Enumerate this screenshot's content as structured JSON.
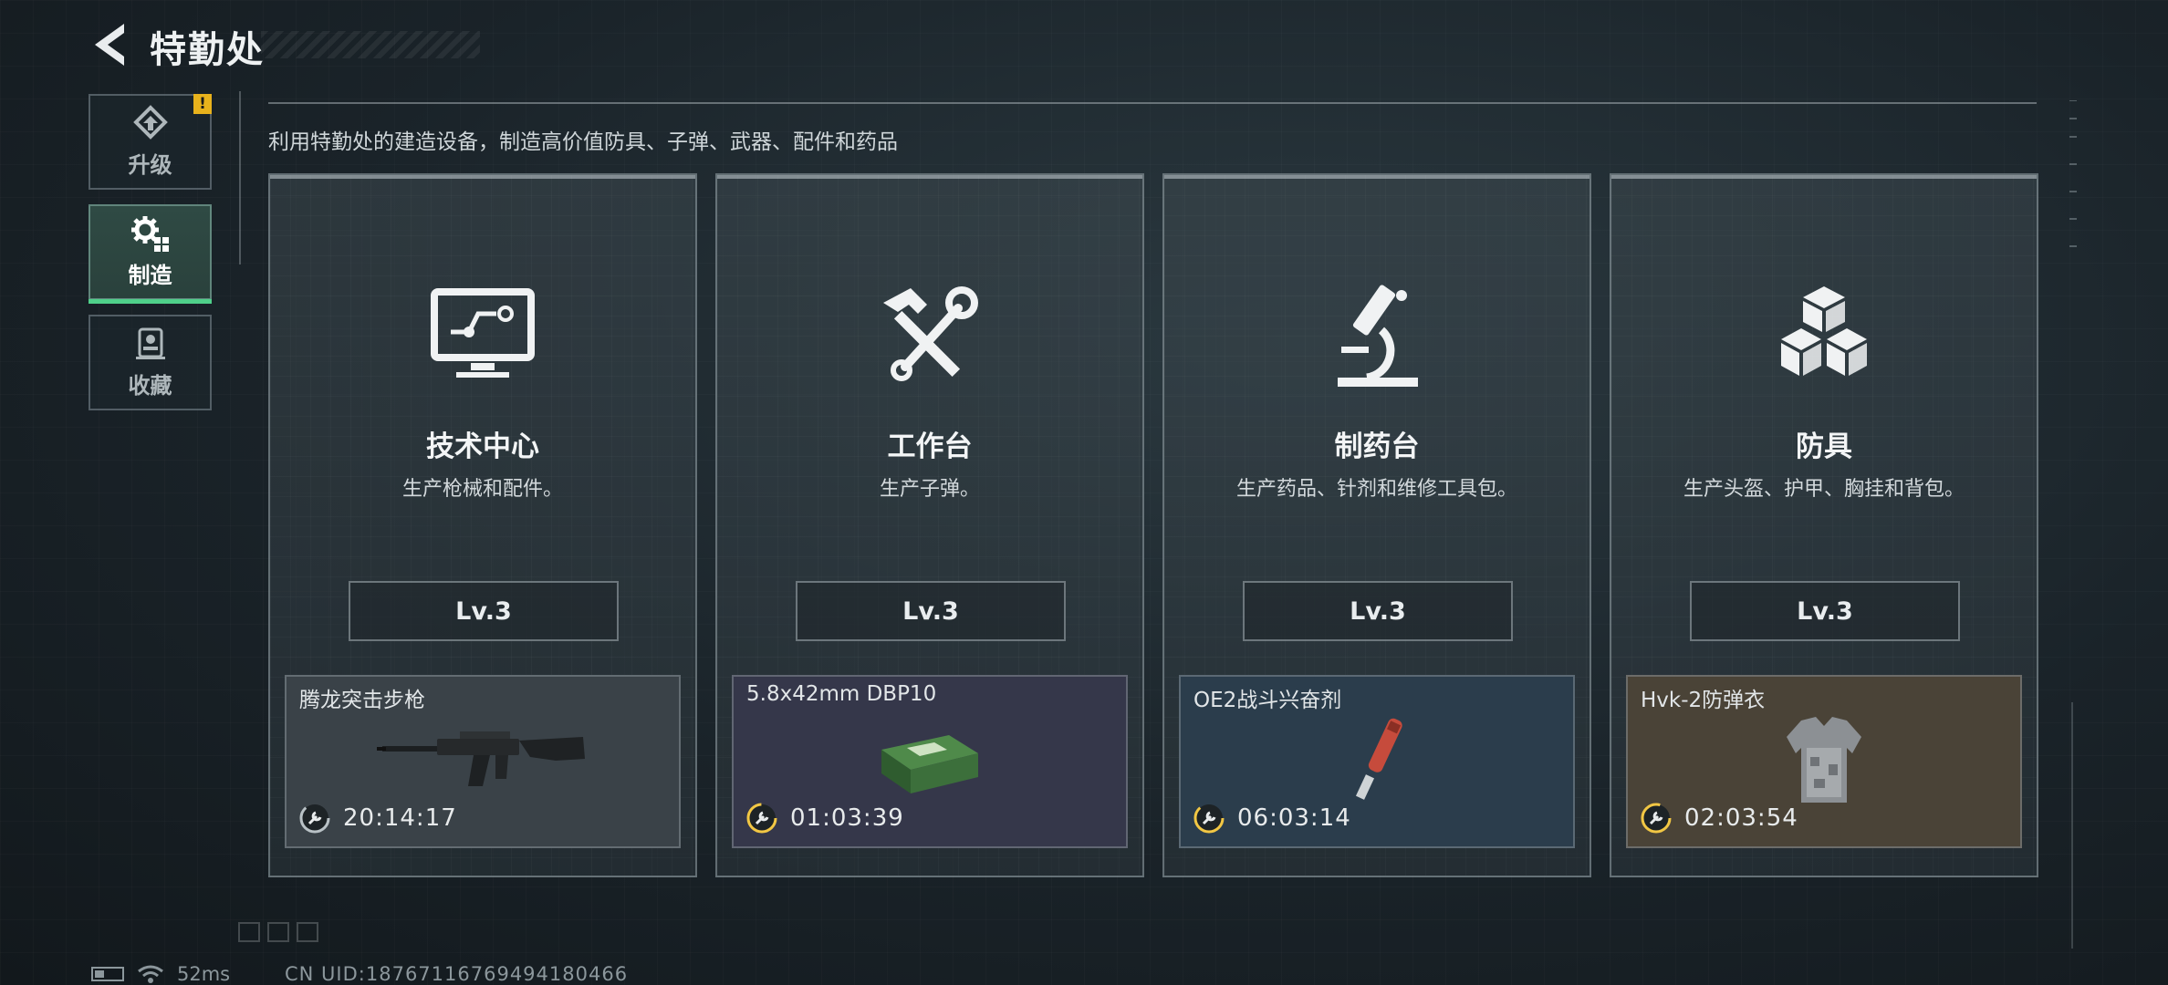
{
  "header": {
    "title": "特勤处"
  },
  "sidebar": {
    "items": [
      {
        "label": "升级",
        "icon": "upgrade-icon",
        "active": false,
        "alert": "!"
      },
      {
        "label": "制造",
        "icon": "gear-icon",
        "active": true
      },
      {
        "label": "收藏",
        "icon": "collection-icon",
        "active": false
      }
    ]
  },
  "main": {
    "subtitle": "利用特勤处的建造设备，制造高价值防具、子弹、武器、配件和药品",
    "cards": [
      {
        "title": "技术中心",
        "description": "生产枪械和配件。",
        "icon": "monitor-icon",
        "level": "Lv.3",
        "production": {
          "item": "腾龙突击步枪",
          "timer": "20:14:17",
          "image": "rifle-icon",
          "bg": "#3a4248",
          "timer_color": "#b9c2c6"
        }
      },
      {
        "title": "工作台",
        "description": "生产子弹。",
        "icon": "hammer-wrench-icon",
        "level": "Lv.3",
        "production": {
          "item": "5.8x42mm DBP10",
          "timer": "01:03:39",
          "image": "ammo-box-icon",
          "bg": "#35374a",
          "timer_color": "#f2c744"
        }
      },
      {
        "title": "制药台",
        "description": "生产药品、针剂和维修工具包。",
        "icon": "microscope-icon",
        "level": "Lv.3",
        "production": {
          "item": "OE2战斗兴奋剂",
          "timer": "06:03:14",
          "image": "injector-icon",
          "bg": "#2b3d4c",
          "timer_color": "#f2c744"
        }
      },
      {
        "title": "防具",
        "description": "生产头盔、护甲、胸挂和背包。",
        "icon": "cubes-icon",
        "level": "Lv.3",
        "production": {
          "item": "Hvk-2防弹衣",
          "timer": "02:03:54",
          "image": "body-armor-icon",
          "bg": "#4a4337",
          "timer_color": "#f2c744"
        }
      }
    ]
  },
  "status_bar": {
    "ping": "52ms",
    "uid": "CN UID:18767116769494180466"
  }
}
